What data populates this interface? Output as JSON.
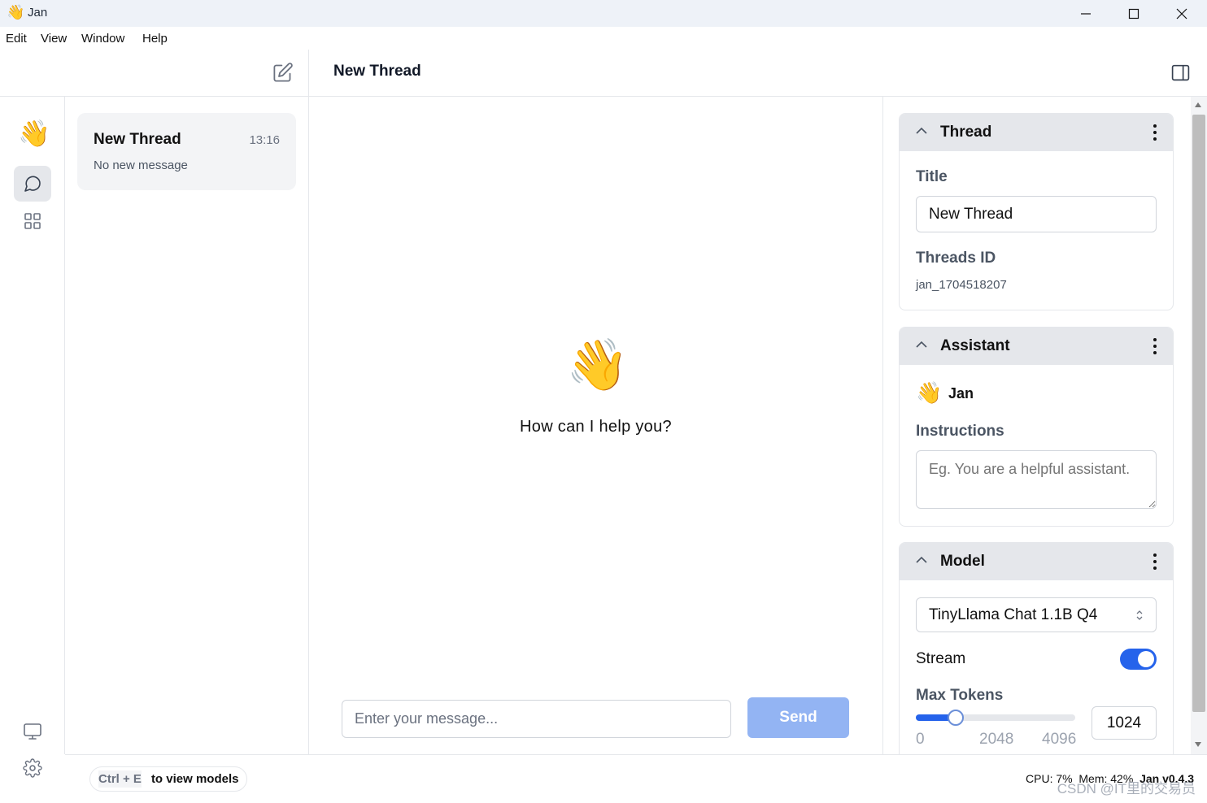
{
  "window": {
    "icon": "👋",
    "title": "Jan"
  },
  "menu": [
    "Edit",
    "View",
    "Window",
    "Help"
  ],
  "header": {
    "title": "New Thread"
  },
  "rail": {
    "logo": "👋"
  },
  "threads": [
    {
      "title": "New Thread",
      "time": "13:16",
      "subtitle": "No new message"
    }
  ],
  "chat": {
    "emoji": "👋",
    "prompt": "How can I help you?",
    "input_placeholder": "Enter your message...",
    "send_label": "Send"
  },
  "right_panel": {
    "thread": {
      "title": "Thread",
      "title_label": "Title",
      "title_value": "New Thread",
      "id_label": "Threads ID",
      "id_value": "jan_1704518207"
    },
    "assistant": {
      "title": "Assistant",
      "emoji": "👋",
      "name": "Jan",
      "instructions_label": "Instructions",
      "instructions_placeholder": "Eg. You are a helpful assistant."
    },
    "model": {
      "title": "Model",
      "selected": "TinyLlama Chat 1.1B Q4",
      "stream_label": "Stream",
      "stream_on": true,
      "max_tokens_label": "Max Tokens",
      "max_tokens_value": "1024",
      "slider_min": "0",
      "slider_mid": "2048",
      "slider_max": "4096",
      "slider_fraction": 0.25
    }
  },
  "statusbar": {
    "shortcut": "Ctrl + E",
    "hint": "to view models",
    "system": "CPU: 7%  Mem: 42%",
    "version": "Jan v0.4.3",
    "watermark": "CSDN @IT里的交易员"
  },
  "colors": {
    "accent": "#2563eb",
    "send_disabled": "#93b4f3",
    "card_header": "#e5e7eb"
  }
}
